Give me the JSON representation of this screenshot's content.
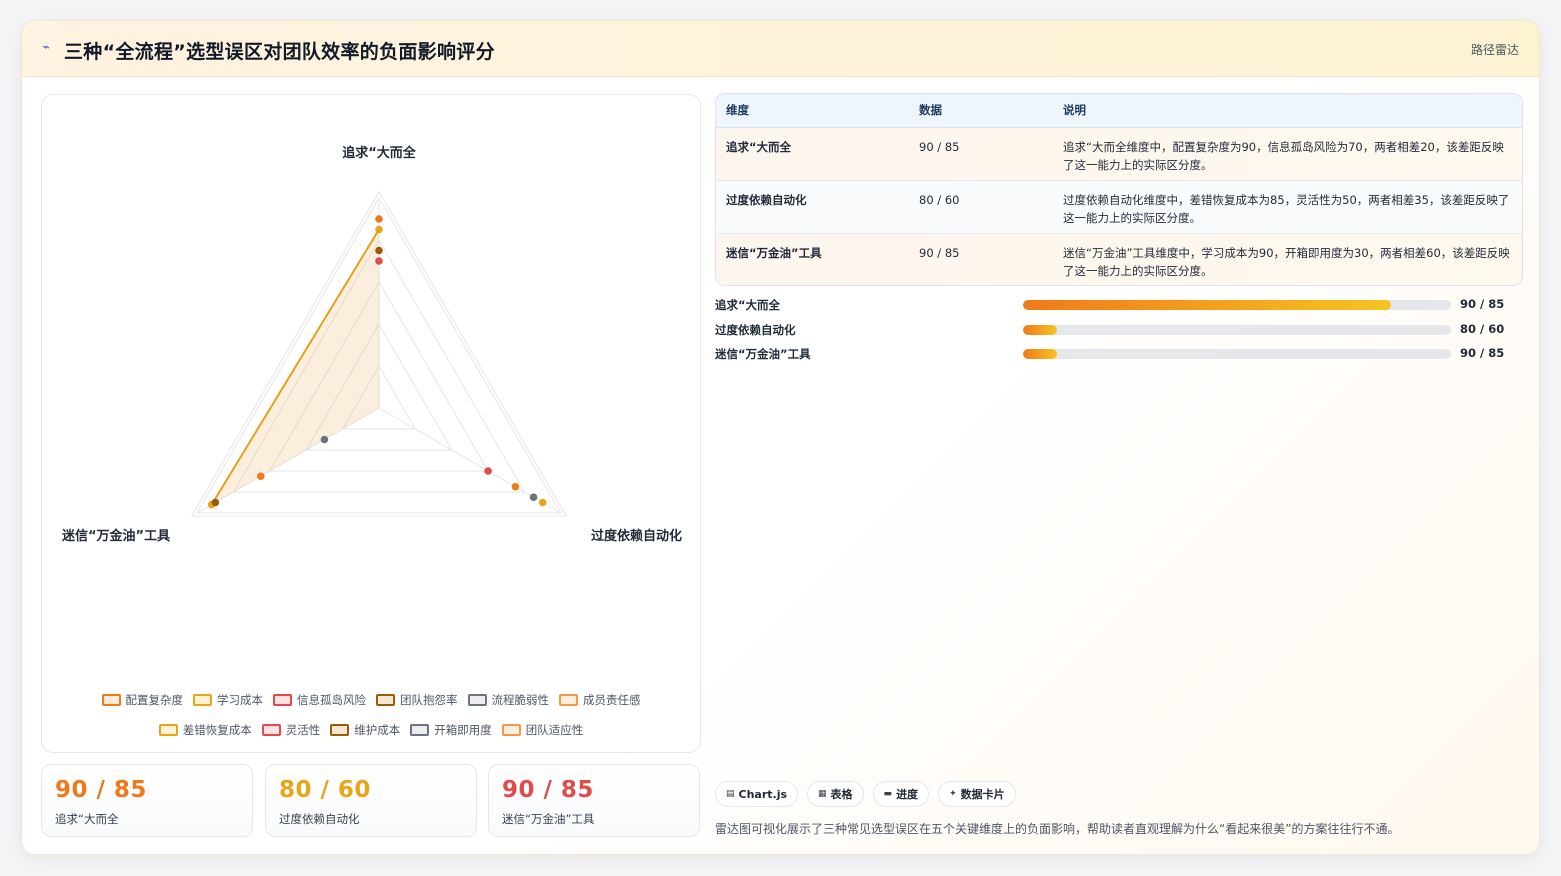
{
  "header": {
    "title_icon": "chart-spark-icon",
    "title": "三种“全流程”选型误区对团队效率的负面影响评分",
    "tag": "路径雷达"
  },
  "colors": {
    "orange": "#ee7a1c",
    "amber": "#e9a51a",
    "red": "#e04b4b",
    "brown": "#9a5b08",
    "slate": "#6b7280",
    "light_orange": "#f29a4a"
  },
  "chart_data": {
    "type": "radar",
    "axes": [
      "追求“大而全",
      "过度依赖自动化",
      "迷信“万金油”工具"
    ],
    "rlim": [
      0,
      100
    ],
    "grid_levels": 5,
    "series": [
      {
        "name": "配置复杂度",
        "color": "#ee7a1c",
        "values": [
          90,
          75,
          65
        ]
      },
      {
        "name": "学习成本",
        "color": "#e9a51a",
        "values": [
          85,
          90,
          92
        ]
      },
      {
        "name": "信息孤岛风险",
        "color": "#e04b4b",
        "values": [
          70,
          60,
          null
        ]
      },
      {
        "name": "团队抱怨率",
        "color": "#9a5b08",
        "values": [
          75,
          null,
          90
        ]
      },
      {
        "name": "流程脆弱性",
        "color": "#6b7280",
        "values": [
          null,
          85,
          30
        ]
      },
      {
        "name": "成员责任感",
        "color": "#f29a4a",
        "values": [
          null,
          null,
          null
        ]
      },
      {
        "name": "差错恢复成本",
        "color": "#e9a51a",
        "values": [
          null,
          null,
          null
        ]
      },
      {
        "name": "灵活性",
        "color": "#e04b4b",
        "values": [
          null,
          null,
          null
        ]
      },
      {
        "name": "维护成本",
        "color": "#9a5b08",
        "values": [
          null,
          null,
          null
        ]
      },
      {
        "name": "开箱即用度",
        "color": "#6b7280",
        "values": [
          null,
          null,
          null
        ]
      },
      {
        "name": "团队适应性",
        "color": "#f29a4a",
        "values": [
          null,
          null,
          null
        ]
      }
    ],
    "area_series": {
      "name": "学习成本",
      "values": [
        85,
        0,
        92
      ]
    },
    "legend_position": "bottom"
  },
  "legend": [
    {
      "label": "配置复杂度",
      "color": "#ee7a1c",
      "fill": "#fdebd8"
    },
    {
      "label": "学习成本",
      "color": "#e9a51a",
      "fill": "#fdf1d6"
    },
    {
      "label": "信息孤岛风险",
      "color": "#e04b4b",
      "fill": "#fbe1e1"
    },
    {
      "label": "团队抱怨率",
      "color": "#9a5b08",
      "fill": "#f3e7d4"
    },
    {
      "label": "流程脆弱性",
      "color": "#6b7280",
      "fill": "#eceef1"
    },
    {
      "label": "成员责任感",
      "color": "#f29a4a",
      "fill": "#fdeede"
    },
    {
      "label": "差错恢复成本",
      "color": "#e9a51a",
      "fill": "#fdf1d6"
    },
    {
      "label": "灵活性",
      "color": "#e04b4b",
      "fill": "#fbe1e1"
    },
    {
      "label": "维护成本",
      "color": "#9a5b08",
      "fill": "#f3e7d4"
    },
    {
      "label": "开箱即用度",
      "color": "#6b7280",
      "fill": "#eceef1"
    },
    {
      "label": "团队适应性",
      "color": "#f29a4a",
      "fill": "#fdeede"
    }
  ],
  "stats": [
    {
      "value": "90 / 85",
      "label": "追求“大而全",
      "color": "#ee7a1c"
    },
    {
      "value": "80 / 60",
      "label": "过度依赖自动化",
      "color": "#e9a51a"
    },
    {
      "value": "90 / 85",
      "label": "迷信“万金油”工具",
      "color": "#e04b4b"
    }
  ],
  "table": {
    "headers": [
      "维度",
      "数据",
      "说明"
    ],
    "rows": [
      {
        "dim": "追求“大而全",
        "data": "90 / 85",
        "desc": "追求“大而全维度中，配置复杂度为90，信息孤岛风险为70，两者相差20，该差距反映了这一能力上的实际区分度。"
      },
      {
        "dim": "过度依赖自动化",
        "data": "80 / 60",
        "desc": "过度依赖自动化维度中，差错恢复成本为85，灵活性为50，两者相差35，该差距反映了这一能力上的实际区分度。"
      },
      {
        "dim": "迷信“万金油”工具",
        "data": "90 / 85",
        "desc": "迷信“万金油”工具维度中，学习成本为90，开箱即用度为30，两者相差60，该差距反映了这一能力上的实际区分度。"
      }
    ]
  },
  "progress": [
    {
      "label": "追求“大而全",
      "value": "90 / 85",
      "fill": 0.86
    },
    {
      "label": "过度依赖自动化",
      "value": "80 / 60",
      "fill": 0.08
    },
    {
      "label": "迷信“万金油”工具",
      "value": "90 / 85",
      "fill": 0.08
    }
  ],
  "chips": [
    {
      "icon": "▤",
      "icon_name": "chartjs-icon",
      "label": "Chart.js"
    },
    {
      "icon": "▦",
      "icon_name": "table-icon",
      "label": "表格"
    },
    {
      "icon": "▬",
      "icon_name": "progress-icon",
      "label": "进度"
    },
    {
      "icon": "✦",
      "icon_name": "data-card-icon",
      "label": "数据卡片"
    }
  ],
  "note": "雷达图可视化展示了三种常见选型误区在五个关键维度上的负面影响，帮助读者直观理解为什么“看起来很美”的方案往往行不通。"
}
